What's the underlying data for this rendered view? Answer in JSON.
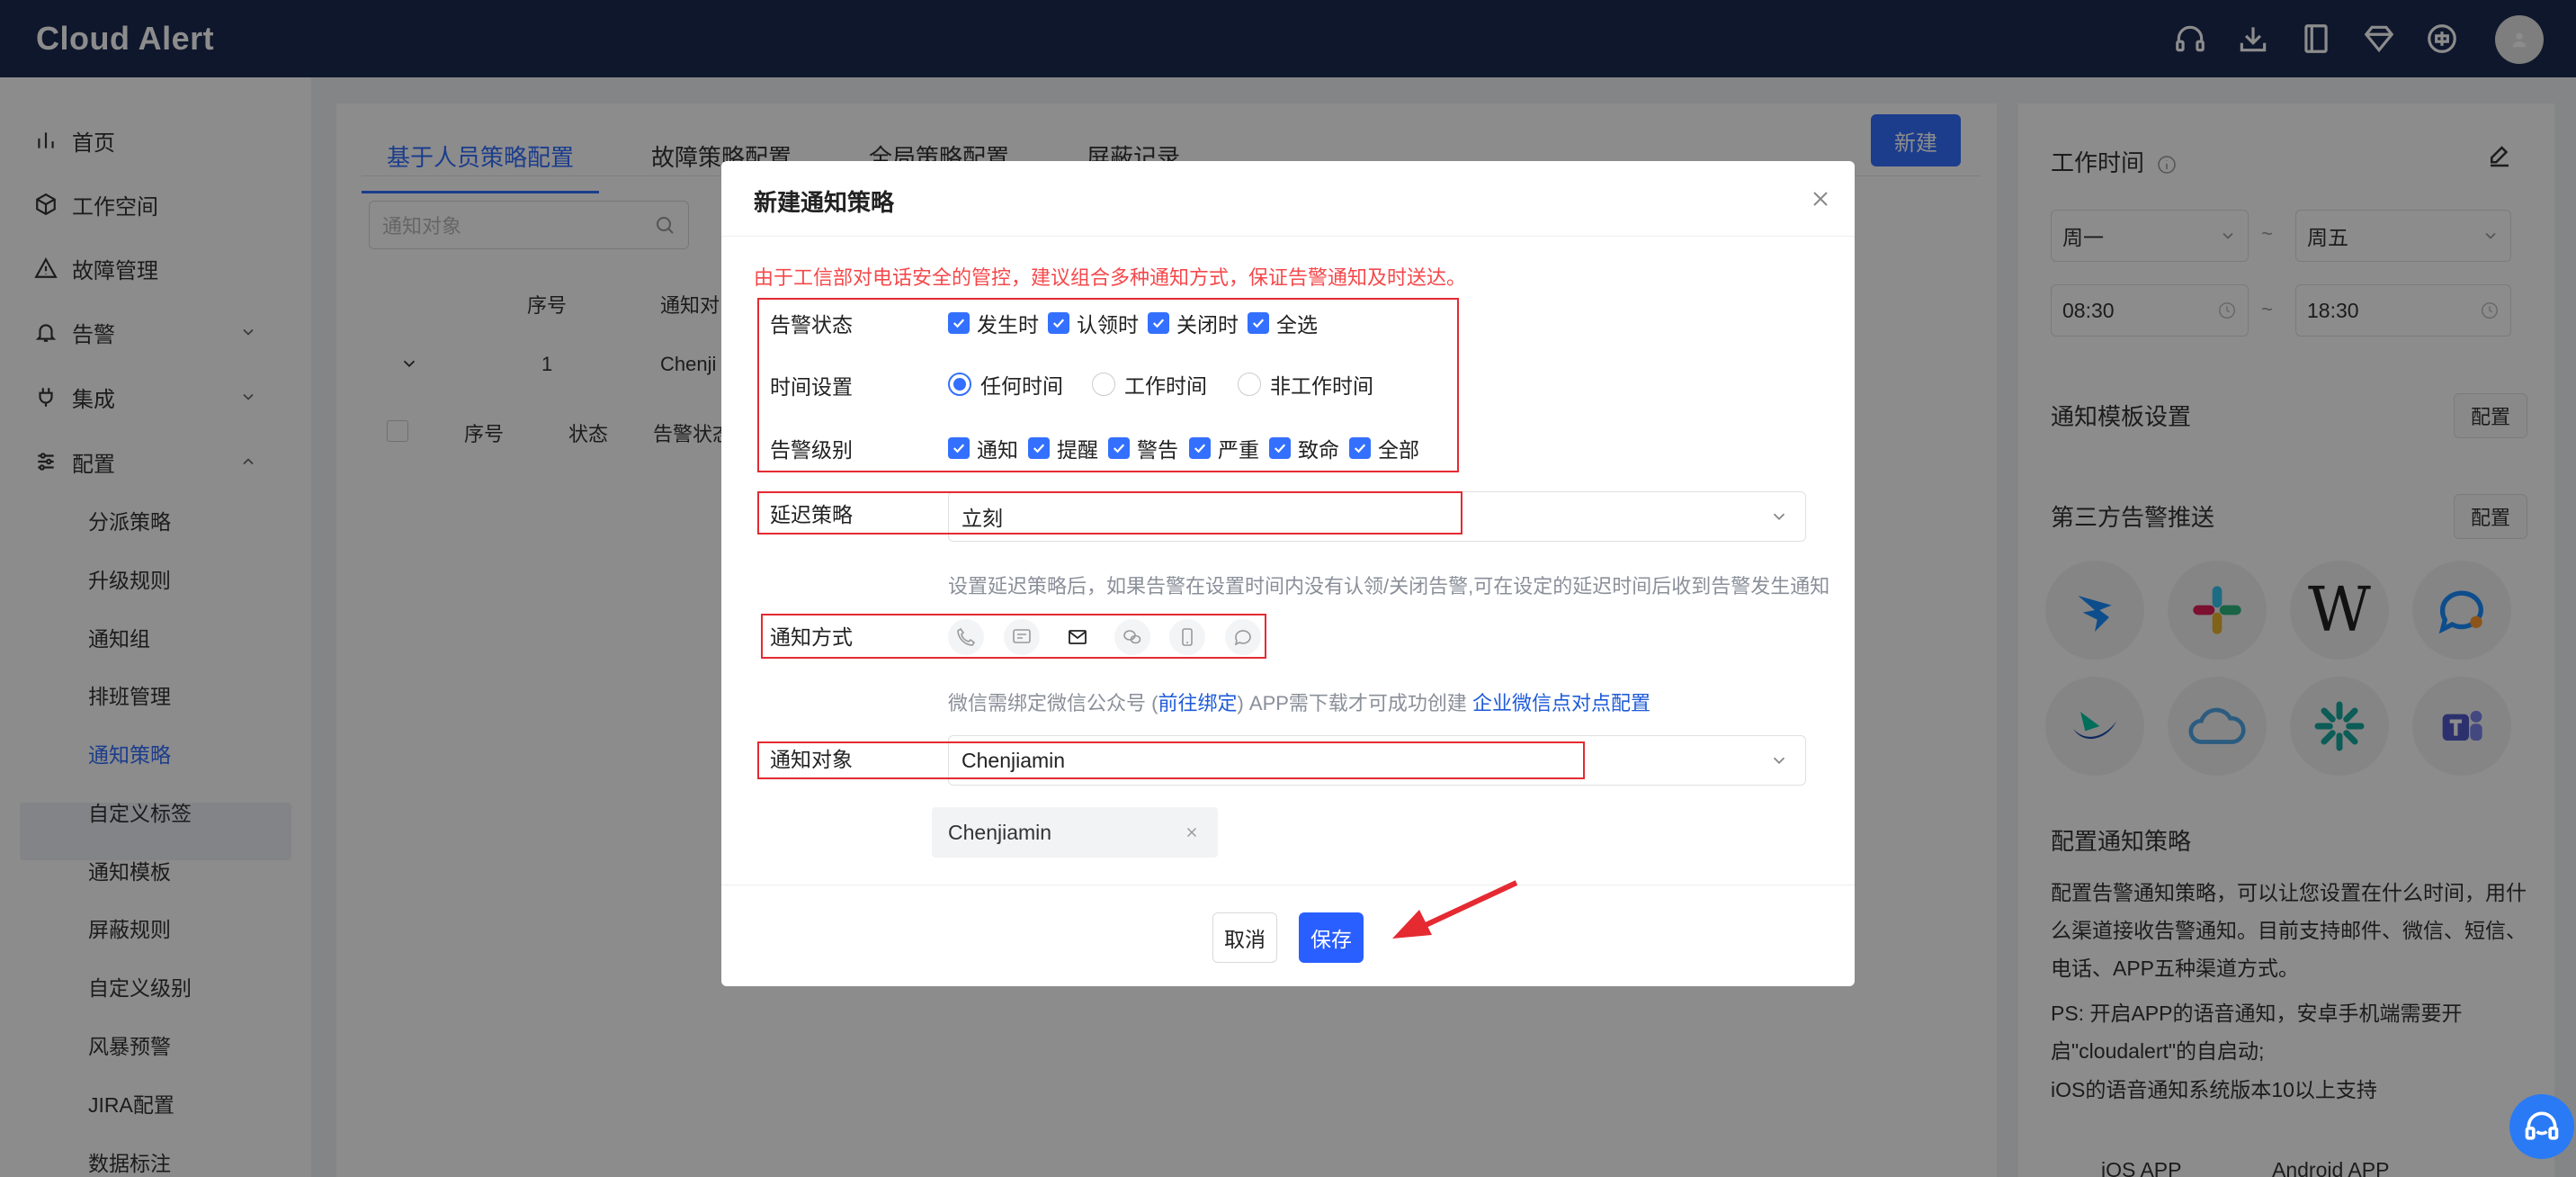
{
  "app": {
    "title": "Cloud Alert"
  },
  "topbar_icons": [
    "headset-icon",
    "download-icon",
    "book-icon",
    "diamond-icon",
    "language-icon"
  ],
  "sidebar": {
    "items": [
      {
        "label": "首页",
        "icon": "chart-icon"
      },
      {
        "label": "工作空间",
        "icon": "cube-icon"
      },
      {
        "label": "故障管理",
        "icon": "warning-icon"
      },
      {
        "label": "告警",
        "icon": "bell-icon"
      },
      {
        "label": "集成",
        "icon": "plug-icon"
      },
      {
        "label": "配置",
        "icon": "sliders-icon"
      }
    ],
    "sub_items": [
      "分派策略",
      "升级规则",
      "通知组",
      "排班管理",
      "通知策略",
      "自定义标签",
      "通知模板",
      "屏蔽规则",
      "自定义级别",
      "风暴预警",
      "JIRA配置",
      "数据标注"
    ],
    "active_sub": "通知策略"
  },
  "main": {
    "tabs": [
      "基于人员策略配置",
      "故障策略配置",
      "全局策略配置",
      "屏蔽记录"
    ],
    "active_tab": "基于人员策略配置",
    "new_button": "新建",
    "search_placeholder": "通知对象",
    "table_header": {
      "index": "序号",
      "target": "通知对"
    },
    "row": {
      "index": "1",
      "target": "Chenji"
    },
    "sub_header": {
      "index": "序号",
      "status": "状态",
      "alert_status": "告警状态"
    }
  },
  "right_panel": {
    "work_time_title": "工作时间",
    "day_from": "周一",
    "day_to": "周五",
    "time_from": "08:30",
    "time_to": "18:30",
    "separator": "~",
    "template_title": "通知模板设置",
    "template_btn": "配置",
    "thirdparty_title": "第三方告警推送",
    "thirdparty_btn": "配置",
    "config_title": "配置通知策略",
    "config_desc": "配置告警通知策略，可以让您设置在什么时间，用什么渠道接收告警通知。目前支持邮件、微信、短信、电话、APP五种渠道方式。",
    "ps_text_1": "PS: 开启APP的语音通知，安卓手机端需要开启\"cloudalert\"的自启动;",
    "ps_text_2": "iOS的语音通知系统版本10以上支持",
    "app_ios": "iOS APP",
    "app_android": "Android APP"
  },
  "modal": {
    "title": "新建通知策略",
    "warning": "由于工信部对电话安全的管控，建议组合多种通知方式，保证告警通知及时送达。",
    "alert_status_label": "告警状态",
    "alert_status_options": [
      "发生时",
      "认领时",
      "关闭时",
      "全选"
    ],
    "time_label": "时间设置",
    "time_options": [
      "任何时间",
      "工作时间",
      "非工作时间"
    ],
    "time_selected": "任何时间",
    "level_label": "告警级别",
    "level_options": [
      "通知",
      "提醒",
      "警告",
      "严重",
      "致命",
      "全部"
    ],
    "delay_label": "延迟策略",
    "delay_value": "立刻",
    "delay_hint": "设置延迟策略后，如果告警在设置时间内没有认领/关闭告警,可在设定的延迟时间后收到告警发生通知",
    "method_label": "通知方式",
    "method_icons": [
      "phone-icon",
      "sms-icon",
      "email-icon",
      "wechat-icon",
      "app-icon",
      "chat-icon"
    ],
    "wechat_hint_prefix": "微信需绑定微信公众号 (",
    "wechat_link": "前往绑定",
    "wechat_hint_mid": ") APP需下载才可成功创建 ",
    "wechat_link2": "企业微信点对点配置",
    "target_label": "通知对象",
    "target_value": "Chenjiamin",
    "target_tag": "Chenjiamin",
    "cancel": "取消",
    "save": "保存"
  },
  "colors": {
    "accent": "#3370ff",
    "topbar": "#1d2a52",
    "warning": "#f5484b",
    "highlight_box": "#e52a32"
  }
}
